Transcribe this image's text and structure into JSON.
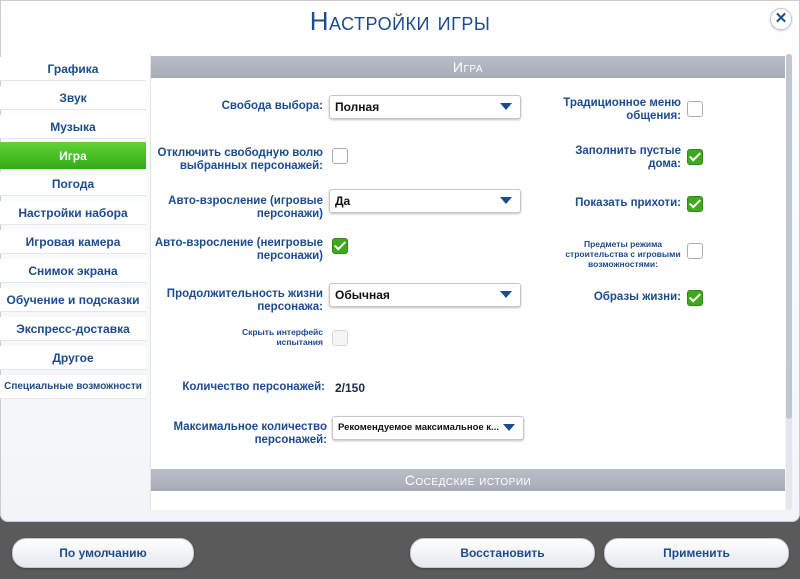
{
  "window": {
    "title": "Настройки игры",
    "close_icon": "✕"
  },
  "sidebar": {
    "items": [
      {
        "label": "Графика"
      },
      {
        "label": "Звук"
      },
      {
        "label": "Музыка"
      },
      {
        "label": "Игра",
        "active": true
      },
      {
        "label": "Погода"
      },
      {
        "label": "Настройки набора"
      },
      {
        "label": "Игровая камера"
      },
      {
        "label": "Снимок экрана"
      },
      {
        "label": "Обучение и подсказки"
      },
      {
        "label": "Экспресс-доставка"
      },
      {
        "label": "Другое"
      },
      {
        "label": "Специальные возможности"
      }
    ]
  },
  "section": {
    "title": "Игра",
    "free_will": {
      "label": "Свобода выбора:",
      "value": "Полная"
    },
    "disable_free_will": {
      "label": "Отключить свободную волю выбранных персонажей:",
      "checked": false
    },
    "auto_age_played": {
      "label": "Авто-взросление (игровые персонажи)",
      "value": "Да"
    },
    "auto_age_unplayed": {
      "label": "Авто-взросление (неигровые персонажи)",
      "checked": true
    },
    "lifespan": {
      "label": "Продолжительность жизни персонажа:",
      "value": "Обычная"
    },
    "hide_challenge_ui": {
      "label": "Скрыть интерфейс испытания",
      "checked": false,
      "disabled": true
    },
    "sim_count": {
      "label": "Количество персонажей:",
      "value": "2/150"
    },
    "max_sims": {
      "label": "Максимальное количество персонажей:",
      "value": "Рекомендуемое максимальное к..."
    },
    "classic_social_menu": {
      "label": "Традиционное меню общения:",
      "checked": false
    },
    "fill_empty_houses": {
      "label": "Заполнить пустые дома:",
      "checked": true
    },
    "show_whims": {
      "label": "Показать прихоти:",
      "checked": true
    },
    "build_mode_items": {
      "label": "Предметы режима строительства с игровыми возможностями:",
      "checked": false
    },
    "lifestyles": {
      "label": "Образы жизни:",
      "checked": true
    }
  },
  "section2": {
    "title": "Соседские истории"
  },
  "footer": {
    "default_label": "По умолчанию",
    "restore_label": "Восстановить",
    "apply_label": "Применить"
  }
}
